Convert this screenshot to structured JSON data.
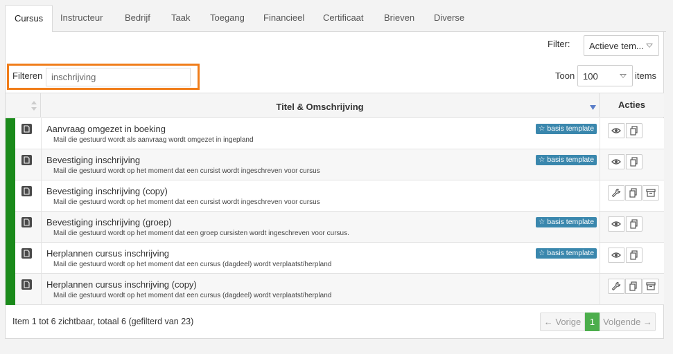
{
  "tabs": [
    {
      "label": "Cursus"
    },
    {
      "label": "Instructeur"
    },
    {
      "label": "Bedrijf"
    },
    {
      "label": "Taak"
    },
    {
      "label": "Toegang"
    },
    {
      "label": "Financieel"
    },
    {
      "label": "Certificaat"
    },
    {
      "label": "Brieven"
    },
    {
      "label": "Diverse"
    }
  ],
  "toolbar": {
    "filter_label": "Filter:",
    "filter_value": "Actieve tem...",
    "search_label": "Filteren",
    "search_value": "inschrijving",
    "show_label": "Toon",
    "show_value": "100",
    "items_label": "items"
  },
  "table": {
    "col_title": "Titel & Omschrijving",
    "col_actions": "Acties",
    "rows": [
      {
        "title": "Aanvraag omgezet in boeking",
        "desc": "Mail die gestuurd wordt als aanvraag wordt omgezet in ingepland",
        "badge": "basis template"
      },
      {
        "title": "Bevestiging inschrijving",
        "desc": "Mail die gestuurd wordt op het moment dat een cursist wordt ingeschreven voor cursus",
        "badge": "basis template"
      },
      {
        "title": "Bevestiging inschrijving (copy)",
        "desc": "Mail die gestuurd wordt op het moment dat een cursist wordt ingeschreven voor cursus",
        "badge": ""
      },
      {
        "title": "Bevestiging inschrijving (groep)",
        "desc": "Mail die gestuurd wordt op het moment dat een groep cursisten wordt ingeschreven voor cursus.",
        "badge": "basis template"
      },
      {
        "title": "Herplannen cursus inschrijving",
        "desc": "Mail die gestuurd wordt op het moment dat een cursus (dagdeel) wordt verplaatst/herpland",
        "badge": "basis template"
      },
      {
        "title": "Herplannen cursus inschrijving (copy)",
        "desc": "Mail die gestuurd wordt op het moment dat een cursus (dagdeel) wordt verplaatst/herpland",
        "badge": ""
      }
    ]
  },
  "footer": {
    "info": "Item 1 tot 6 zichtbaar, totaal 6 (gefilterd van 23)",
    "prev": "← Vorige",
    "page": "1",
    "next": "Volgende →"
  },
  "colors": {
    "status_active": "#1a8a1a",
    "badge": "#3a87ad",
    "highlight": "#f07d1a",
    "page_current": "#4cae4c"
  }
}
